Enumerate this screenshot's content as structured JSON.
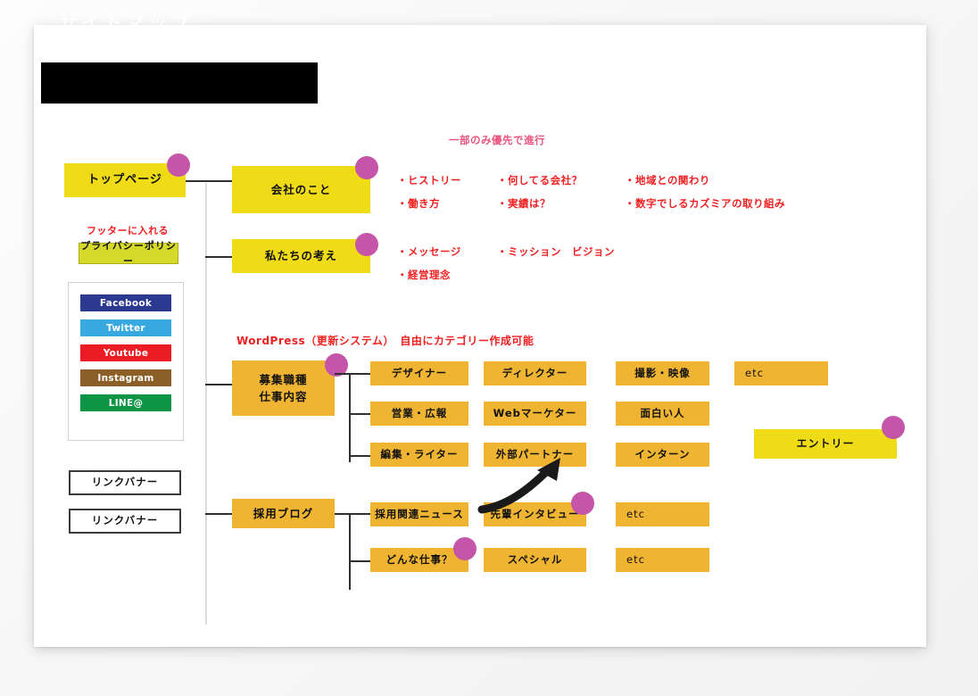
{
  "page": {
    "title": "サイトマップ"
  },
  "colors": {
    "yellow": "#EFDB16",
    "orange": "#EFB432",
    "lime": "#D5D92A",
    "magenta": "#C555A8",
    "red": "#F02020",
    "pink": "#E9547F",
    "black": "#000000"
  },
  "nodes": {
    "top_page": "トップページ",
    "privacy_policy": "プライバシーポリシー",
    "company": "会社のこと",
    "our_thinking": "私たちの考え",
    "jobs_line1": "募集職種",
    "jobs_line2": "仕事内容",
    "recruit_blog": "採用ブログ",
    "entry": "エントリー",
    "link_banner_1": "リンクバナー",
    "link_banner_2": "リンクバナー"
  },
  "notes": {
    "footer_note": "フッターに入れる",
    "priority_note": "一部のみ優先で進行",
    "wordpress_note": "WordPress（更新システム）　自由にカテゴリー作成可能"
  },
  "company_items": [
    {
      "label": "・ヒストリー",
      "col": 1,
      "row": 1
    },
    {
      "label": "・働き方",
      "col": 1,
      "row": 2
    },
    {
      "label": "・何してる会社？",
      "col": 2,
      "row": 1
    },
    {
      "label": "・実績は？",
      "col": 2,
      "row": 2
    },
    {
      "label": "・地域との関わり",
      "col": 3,
      "row": 1
    },
    {
      "label": "・数字でしるカズミアの取り組み",
      "col": 3,
      "row": 2
    }
  ],
  "thinking_items": [
    {
      "label": "・メッセージ",
      "col": 1,
      "row": 1
    },
    {
      "label": "・経営理念",
      "col": 1,
      "row": 2
    },
    {
      "label": "・ミッション　ビジョン",
      "col": 2,
      "row": 1
    }
  ],
  "job_grid": [
    [
      "デザイナー",
      "ディレクター",
      "撮影・映像",
      "etc"
    ],
    [
      "営業・広報",
      "Webマーケター",
      "面白い人",
      ""
    ],
    [
      "編集・ライター",
      "外部パートナー",
      "インターン",
      ""
    ]
  ],
  "blog_grid": [
    [
      "採用関連ニュース",
      "先輩インタビュー",
      "etc"
    ],
    [
      "どんな仕事？",
      "スペシャル",
      "etc"
    ]
  ],
  "social": [
    {
      "label": "Facebook",
      "color": "#2B3990"
    },
    {
      "label": "Twitter",
      "color": "#38A8E0"
    },
    {
      "label": "Youtube",
      "color": "#EC1C24"
    },
    {
      "label": "Instagram",
      "color": "#8C5F29"
    },
    {
      "label": "LINE@",
      "color": "#0B9444"
    }
  ]
}
